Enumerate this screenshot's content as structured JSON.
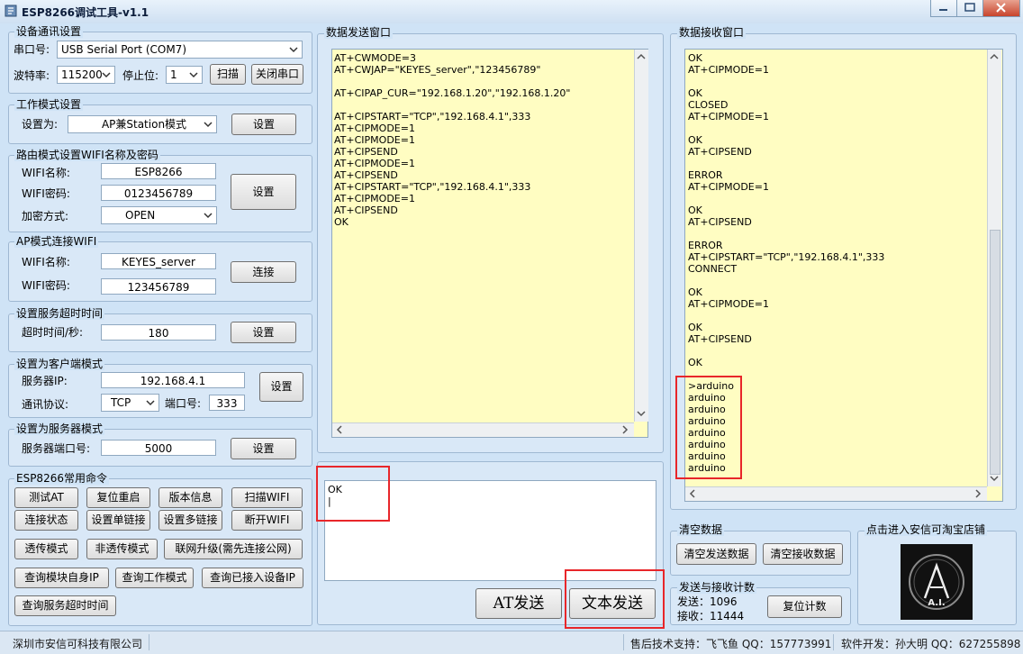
{
  "window": {
    "title": "ESP8266调试工具-v1.1"
  },
  "device": {
    "group_title": "设备通讯设置",
    "port_label": "串口号:",
    "port_value": "USB Serial Port (COM7)",
    "baud_label": "波特率:",
    "baud_value": "115200",
    "stop_label": "停止位:",
    "stop_value": "1",
    "scan_button": "扫描",
    "close_port_button": "关闭串口"
  },
  "workmode": {
    "group_title": "工作模式设置",
    "set_as_label": "设置为:",
    "mode_value": "AP兼Station模式",
    "set_button": "设置"
  },
  "router": {
    "group_title": "路由模式设置WIFI名称及密码",
    "name_label": "WIFI名称:",
    "name_value": "ESP8266",
    "pwd_label": "WIFI密码:",
    "pwd_value": "0123456789",
    "enc_label": "加密方式:",
    "enc_value": "OPEN",
    "set_button": "设置"
  },
  "apconnect": {
    "group_title": "AP模式连接WIFI",
    "name_label": "WIFI名称:",
    "name_value": "KEYES_server",
    "pwd_label": "WIFI密码:",
    "pwd_value": "123456789",
    "connect_button": "连接"
  },
  "timeout": {
    "group_title": "设置服务超时时间",
    "label": "超时时间/秒:",
    "value": "180",
    "set_button": "设置"
  },
  "client": {
    "group_title": "设置为客户端模式",
    "ip_label": "服务器IP:",
    "ip_value": "192.168.4.1",
    "proto_label": "通讯协议:",
    "proto_value": "TCP",
    "port_label": "端口号:",
    "port_value": "333",
    "set_button": "设置"
  },
  "server": {
    "group_title": "设置为服务器模式",
    "port_label": "服务器端口号:",
    "port_value": "5000",
    "set_button": "设置"
  },
  "commands": {
    "group_title": "ESP8266常用命令",
    "test_at": "测试AT",
    "reset": "复位重启",
    "version": "版本信息",
    "scan_wifi": "扫描WIFI",
    "conn_status": "连接状态",
    "single_link": "设置单链接",
    "multi_link": "设置多链接",
    "disconnect_wifi": "断开WIFI",
    "transparent": "透传模式",
    "non_transparent": "非透传模式",
    "cloud_upgrade": "联网升级(需先连接公网)",
    "query_own_ip": "查询模块自身IP",
    "query_work_mode": "查询工作模式",
    "query_connected_ip": "查询已接入设备IP",
    "query_timeout": "查询服务超时时间"
  },
  "send_window": {
    "group_title": "数据发送窗口",
    "text": "AT+CWMODE=3\nAT+CWJAP=\"KEYES_server\",\"123456789\"\n\nAT+CIPAP_CUR=\"192.168.1.20\",\"192.168.1.20\"\n\nAT+CIPSTART=\"TCP\",\"192.168.4.1\",333\nAT+CIPMODE=1\nAT+CIPMODE=1\nAT+CIPSEND\nAT+CIPMODE=1\nAT+CIPSEND\nAT+CIPSTART=\"TCP\",\"192.168.4.1\",333\nAT+CIPMODE=1\nAT+CIPSEND\nOK"
  },
  "input_box": {
    "text": "OK\n|"
  },
  "send_buttons": {
    "at_send": "AT发送",
    "text_send": "文本发送"
  },
  "receive_window": {
    "group_title": "数据接收窗口",
    "text": "OK\nAT+CIPMODE=1\n\nOK\nCLOSED\nAT+CIPMODE=1\n\nOK\nAT+CIPSEND\n\nERROR\nAT+CIPMODE=1\n\nOK\nAT+CIPSEND\n\nERROR\nAT+CIPSTART=\"TCP\",\"192.168.4.1\",333\nCONNECT\n\nOK\nAT+CIPMODE=1\n\nOK\nAT+CIPSEND\n\nOK\n\n>arduino\narduino\narduino\narduino\narduino\narduino\narduino\narduino"
  },
  "clear": {
    "group_title": "清空数据",
    "clear_send": "清空发送数据",
    "clear_receive": "清空接收数据"
  },
  "shop": {
    "group_title": "点击进入安信可淘宝店铺",
    "logo_text": "A.I."
  },
  "counter": {
    "group_title": "发送与接收计数",
    "send_label": "发送：",
    "send_value": "1096",
    "recv_label": "接收：",
    "recv_value": "11444",
    "reset_button": "复位计数"
  },
  "status": {
    "company": "深圳市安信可科技有限公司",
    "support": "售后技术支持：飞飞鱼 QQ：157773991",
    "developer": "软件开发：孙大明 QQ：627255898"
  },
  "colors": {
    "highlight": "#e8262a",
    "text_area": "#fffdc2",
    "window_bg": "#cfe3f6"
  }
}
